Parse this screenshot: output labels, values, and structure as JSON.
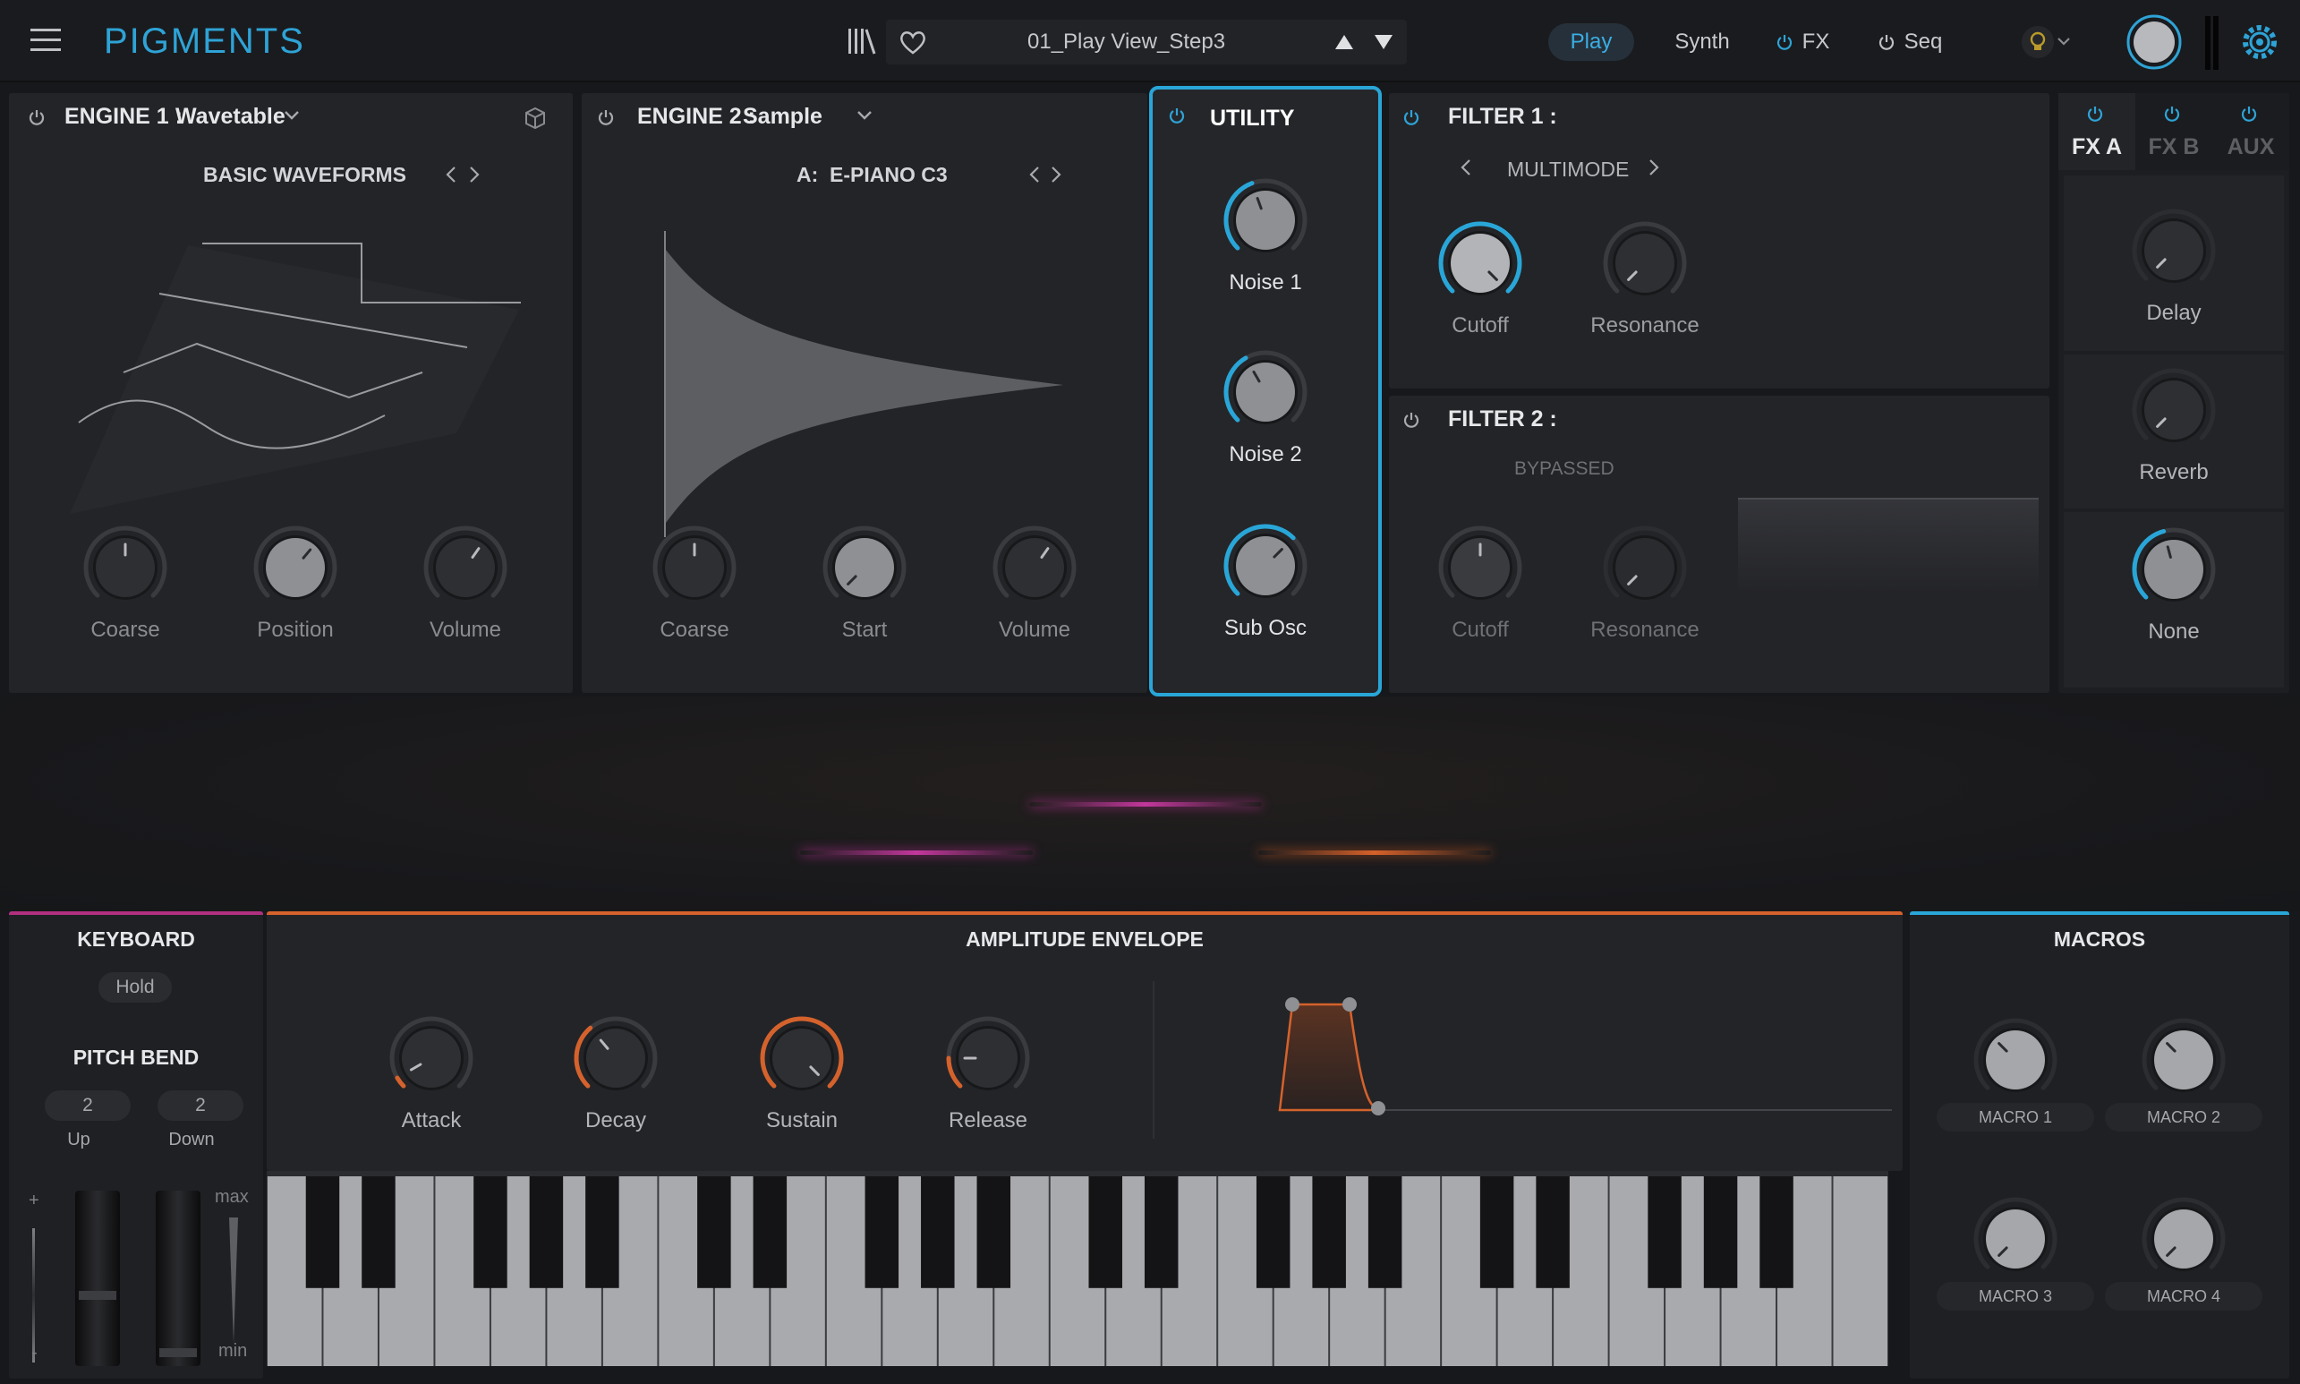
{
  "topbar": {
    "logo": "PIGMENTS",
    "preset": "01_Play View_Step3",
    "tabs": {
      "play": "Play",
      "synth": "Synth",
      "fx": "FX",
      "seq": "Seq"
    }
  },
  "engine1": {
    "title": "ENGINE 1 :",
    "type": "Wavetable",
    "wavetable": "BASIC WAVEFORMS",
    "knobs": {
      "coarse": "Coarse",
      "position": "Position",
      "volume": "Volume"
    }
  },
  "engine2": {
    "title": "ENGINE 2 :",
    "type": "Sample",
    "sample": "A:  E-PIANO C3",
    "knobs": {
      "coarse": "Coarse",
      "start": "Start",
      "volume": "Volume"
    }
  },
  "utility": {
    "title": "UTILITY",
    "knobs": {
      "noise1": "Noise 1",
      "noise2": "Noise 2",
      "subosc": "Sub Osc"
    }
  },
  "filter1": {
    "title": "FILTER 1 :",
    "type": "MULTIMODE",
    "knobs": {
      "cutoff": "Cutoff",
      "resonance": "Resonance"
    }
  },
  "filter2": {
    "title": "FILTER 2 :",
    "type": "BYPASSED",
    "knobs": {
      "cutoff": "Cutoff",
      "resonance": "Resonance"
    }
  },
  "fx": {
    "tabs": {
      "a": "FX A",
      "b": "FX B",
      "aux": "AUX"
    },
    "knobs": {
      "delay": "Delay",
      "reverb": "Reverb",
      "none": "None"
    }
  },
  "keyboard": {
    "title": "KEYBOARD",
    "hold": "Hold",
    "pitchbend_title": "PITCH BEND",
    "up_value": "2",
    "up_label": "Up",
    "down_value": "2",
    "down_label": "Down",
    "plus": "+",
    "minus": "-",
    "max": "max",
    "min": "min"
  },
  "envelope": {
    "title": "AMPLITUDE ENVELOPE",
    "knobs": {
      "attack": "Attack",
      "decay": "Decay",
      "sustain": "Sustain",
      "release": "Release"
    }
  },
  "macros": {
    "title": "MACROS",
    "items": [
      "MACRO 1",
      "MACRO 2",
      "MACRO 3",
      "MACRO 4"
    ]
  },
  "colors": {
    "accent_blue": "#29a6d8",
    "envelope_orange": "#d5622c",
    "keyboard_magenta": "#b1307f"
  }
}
